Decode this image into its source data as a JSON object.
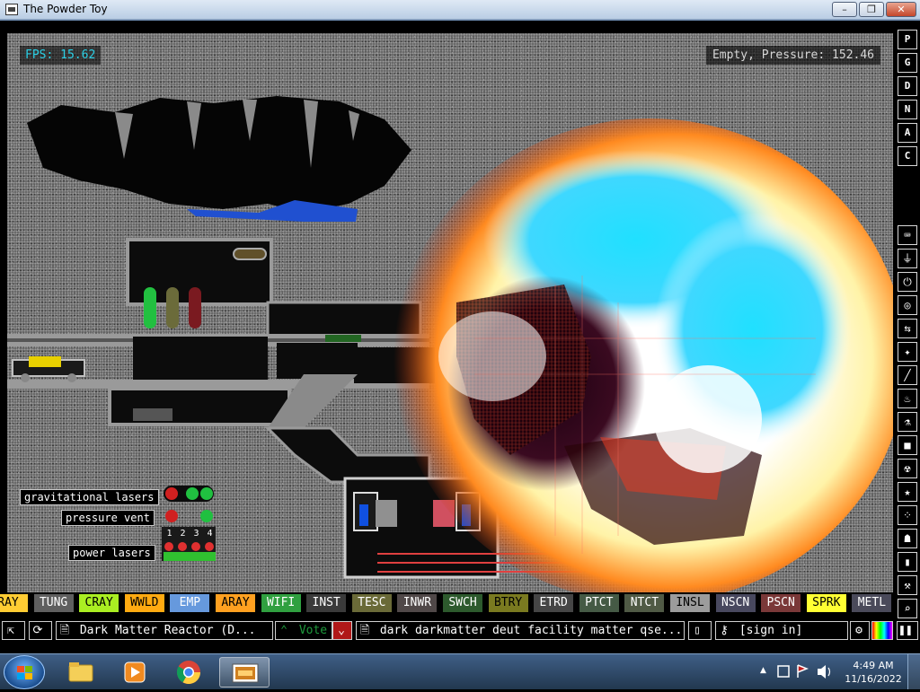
{
  "window": {
    "title": "The Powder Toy",
    "minimize_label": "–",
    "maximize_label": "❐",
    "close_label": "✕"
  },
  "sim": {
    "fps_text": "FPS: 15.62",
    "status_text": "Empty, Pressure: 152.46",
    "signs": [
      "gravitational lasers",
      "pressure vent",
      "power lasers"
    ],
    "digit_labels": [
      "1",
      "2",
      "3",
      "4"
    ]
  },
  "sidebar": {
    "menu_letters": [
      "P",
      "G",
      "D",
      "N",
      "A",
      "C"
    ],
    "category_icons": [
      "keyboard-icon",
      "plug-icon",
      "power-icon",
      "sensor-icon",
      "force-icon",
      "explosive-icon",
      "wrench-icon",
      "flame-icon",
      "flask-icon",
      "solid-icon",
      "radioactive-icon",
      "special-icon",
      "dots-icon",
      "life-icon",
      "bookmark-icon",
      "tools-icon",
      "search-icon"
    ],
    "category_glyphs": [
      "⌨",
      "⏚",
      "⏻",
      "◎",
      "⇆",
      "✦",
      "╱",
      "♨",
      "⚗",
      "■",
      "☢",
      "★",
      "⁘",
      "☗",
      "▮",
      "⚒",
      "⌕"
    ]
  },
  "elements": [
    {
      "label": "RAY",
      "bg": "#ffcc33",
      "fg": "#000000"
    },
    {
      "label": "TUNG",
      "bg": "#5f5f5f",
      "fg": "#ffffff"
    },
    {
      "label": "CRAY",
      "bg": "#aaee22",
      "fg": "#000000"
    },
    {
      "label": "WWLD",
      "bg": "#ffaa11",
      "fg": "#000000"
    },
    {
      "label": "EMP",
      "bg": "#6699dd",
      "fg": "#ffffff"
    },
    {
      "label": "ARAY",
      "bg": "#ffa020",
      "fg": "#000000"
    },
    {
      "label": "WIFI",
      "bg": "#30a040",
      "fg": "#ffffff"
    },
    {
      "label": "INST",
      "bg": "#3a3a3a",
      "fg": "#ffffff"
    },
    {
      "label": "TESC",
      "bg": "#6a6a38",
      "fg": "#ffffff"
    },
    {
      "label": "INWR",
      "bg": "#504848",
      "fg": "#ffffff"
    },
    {
      "label": "SWCH",
      "bg": "#2d5a2d",
      "fg": "#ffffff"
    },
    {
      "label": "BTRY",
      "bg": "#7a7a20",
      "fg": "#000000"
    },
    {
      "label": "ETRD",
      "bg": "#454545",
      "fg": "#ffffff"
    },
    {
      "label": "PTCT",
      "bg": "#455a45",
      "fg": "#ffffff"
    },
    {
      "label": "NTCT",
      "bg": "#505a45",
      "fg": "#ffffff"
    },
    {
      "label": "INSL",
      "bg": "#9c9c9c",
      "fg": "#000000"
    },
    {
      "label": "NSCN",
      "bg": "#48485e",
      "fg": "#ffffff"
    },
    {
      "label": "PSCN",
      "bg": "#7a3838",
      "fg": "#ffffff"
    },
    {
      "label": "SPRK",
      "bg": "#ffff33",
      "fg": "#000000"
    },
    {
      "label": "METL",
      "bg": "#4a4a5a",
      "fg": "#ffffff"
    }
  ],
  "bottombar": {
    "open_icon": "⇱",
    "reload_icon": "⟳",
    "save_icon": "🗎",
    "save_name": "Dark Matter Reactor (D...",
    "vote_up_icon": "⌃",
    "vote_label": "Vote",
    "vote_down_icon": "⌄",
    "tags_icon": "🗎",
    "tags_text": "dark darkmatter deut facility matter qse...",
    "new_icon": "▯",
    "key_icon": "⚷",
    "signin_label": "[sign in]",
    "settings_icon": "⚙",
    "pause_icon": "❚❚"
  },
  "taskbar": {
    "clock_time": "4:49 AM",
    "clock_date": "11/16/2022",
    "tray_arrow": "▲"
  },
  "colors": {
    "fps": "#2ad0e6",
    "sidebar_border": "#d9d9d9",
    "vote_green": "#1e9a3c",
    "vote_down_red": "#b01818"
  }
}
